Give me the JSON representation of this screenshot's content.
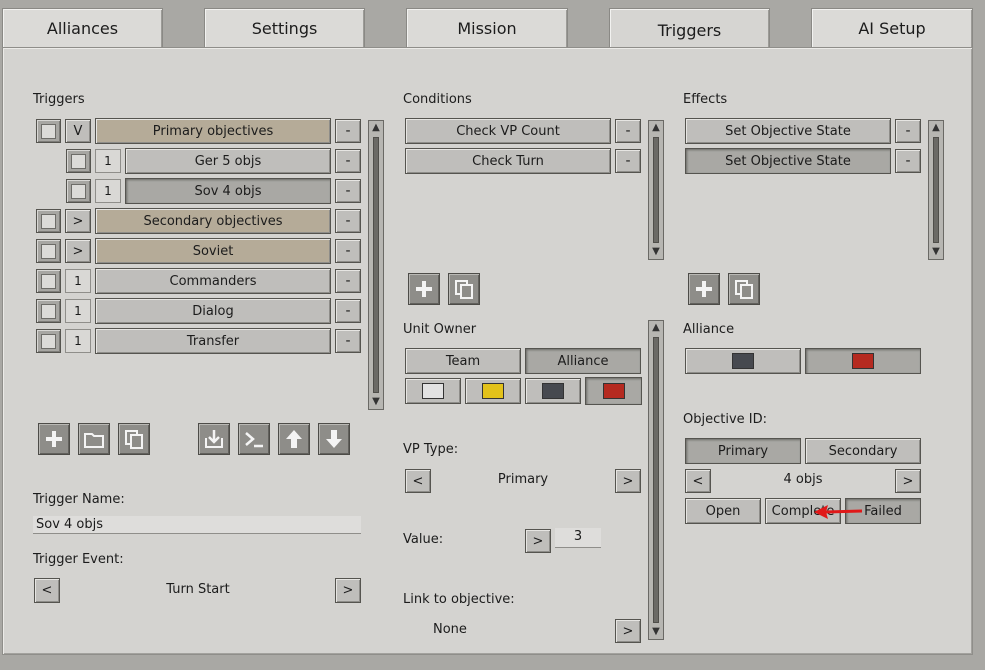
{
  "tabs": [
    "Alliances",
    "Settings",
    "Mission",
    "Triggers",
    "AI Setup"
  ],
  "triggers": {
    "heading": "Triggers",
    "rows": [
      {
        "toggle": "V",
        "label": "Primary objectives",
        "style": "tan"
      },
      {
        "toggle": "1",
        "label": "Ger 5 objs",
        "style": "plain"
      },
      {
        "toggle": "1",
        "label": "Sov 4 objs",
        "style": "plain"
      },
      {
        "toggle": ">",
        "label": "Secondary objectives",
        "style": "tan"
      },
      {
        "toggle": ">",
        "label": "Soviet",
        "style": "tan"
      },
      {
        "toggle": "1",
        "label": "Commanders",
        "style": "plain"
      },
      {
        "toggle": "1",
        "label": "Dialog",
        "style": "plain"
      },
      {
        "toggle": "1",
        "label": "Transfer",
        "style": "plain"
      }
    ],
    "minus": "-",
    "name_label": "Trigger Name:",
    "name_value": "Sov 4 objs",
    "event_label": "Trigger Event:",
    "event_value": "Turn Start",
    "prev": "<",
    "next": ">"
  },
  "conditions": {
    "heading": "Conditions",
    "items": [
      "Check VP Count",
      "Check Turn"
    ],
    "unit_owner_label": "Unit Owner",
    "owner_tabs": [
      "Team",
      "Alliance"
    ],
    "owner_colors": [
      "#e2e2e2",
      "#e3c21a",
      "#46494f",
      "#b52a20"
    ],
    "vp_type_label": "VP Type:",
    "vp_type_value": "Primary",
    "value_label": "Value:",
    "value": "3",
    "link_label": "Link to objective:",
    "link_value": "None",
    "prev": "<",
    "next": ">"
  },
  "effects": {
    "heading": "Effects",
    "items": [
      "Set Objective State",
      "Set Objective State"
    ],
    "alliance_label": "Alliance",
    "alliance_colors": [
      "#46494f",
      "#b52a20"
    ],
    "objective_id_label": "Objective ID:",
    "objective_tabs": [
      "Primary",
      "Secondary"
    ],
    "objective_value": "4 objs",
    "state_buttons": [
      "Open",
      "Complete",
      "Failed"
    ],
    "prev": "<",
    "next": ">"
  },
  "scroll": {
    "up": "▲",
    "down": "▼"
  },
  "icons": {
    "add": "plus-icon",
    "folder": "folder-icon",
    "copy": "copy-icon",
    "import": "import-icon",
    "console": "console-icon",
    "up": "arrow-up-icon",
    "down": "arrow-down-icon"
  },
  "annotation_color": "#e01818"
}
